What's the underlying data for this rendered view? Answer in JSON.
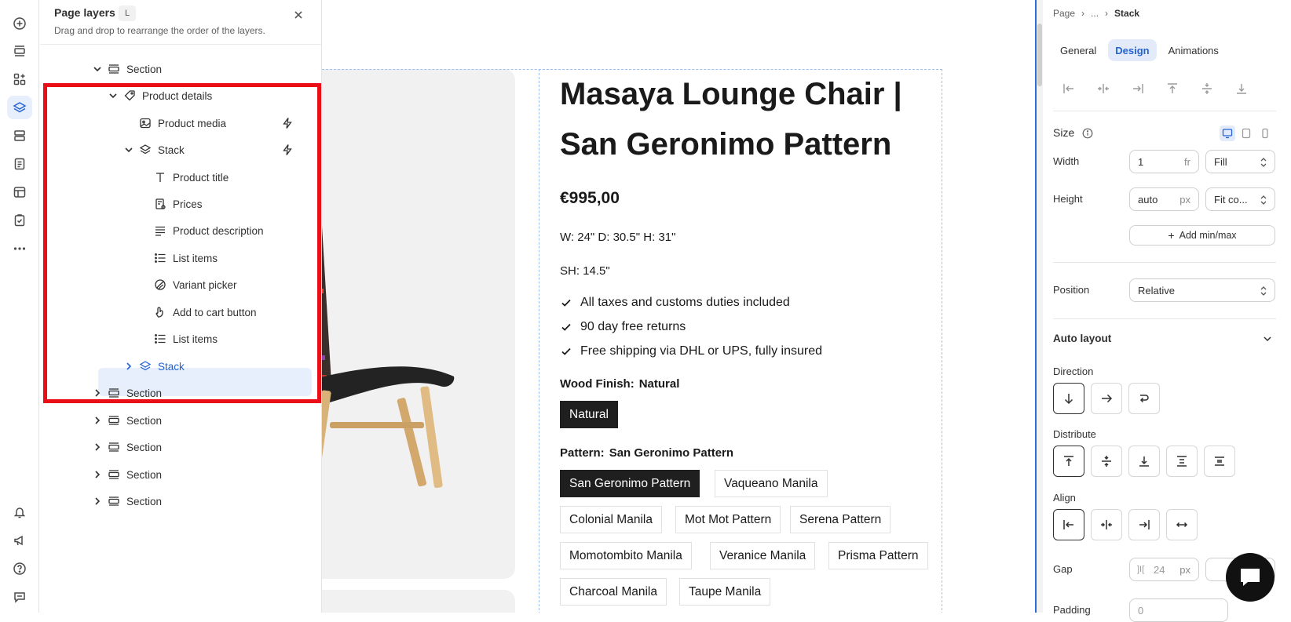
{
  "layers_panel": {
    "title": "Page layers",
    "shortcut": "L",
    "subtitle": "Drag and drop to rearrange the order of the layers.",
    "tree": [
      {
        "label": "Section",
        "icon": "section-icon",
        "expanded": true
      },
      {
        "label": "Product details",
        "icon": "tag-icon",
        "expanded": true
      },
      {
        "label": "Product media",
        "icon": "media-icon",
        "has_dynamic": true
      },
      {
        "label": "Stack",
        "icon": "stack-icon",
        "expanded": true,
        "has_dynamic": true
      },
      {
        "label": "Product title",
        "icon": "text-icon"
      },
      {
        "label": "Prices",
        "icon": "price-icon"
      },
      {
        "label": "Product description",
        "icon": "paragraph-icon"
      },
      {
        "label": "List items",
        "icon": "list-icon"
      },
      {
        "label": "Variant picker",
        "icon": "variant-icon"
      },
      {
        "label": "Add to cart button",
        "icon": "button-icon"
      },
      {
        "label": "List items",
        "icon": "list-icon"
      },
      {
        "label": "Stack",
        "icon": "stack-icon",
        "selected": true
      },
      {
        "label": "Section",
        "icon": "section-icon"
      },
      {
        "label": "Section",
        "icon": "section-icon"
      },
      {
        "label": "Section",
        "icon": "section-icon"
      },
      {
        "label": "Section",
        "icon": "section-icon"
      },
      {
        "label": "Section",
        "icon": "section-icon"
      }
    ]
  },
  "product": {
    "title_line1": "Masaya Lounge Chair |",
    "title_line2": "San Geronimo Pattern",
    "price": "€995,00",
    "dimensions": "W: 24\" D: 30.5\" H: 31\"",
    "seat_height": "SH: 14.5\"",
    "features": [
      "All taxes and customs duties included",
      "90 day free returns",
      "Free shipping via DHL or UPS, fully insured"
    ],
    "wood_finish_label": "Wood Finish:",
    "wood_finish_value": "Natural",
    "wood_finish_options": [
      "Natural"
    ],
    "pattern_label": "Pattern:",
    "pattern_value": "San Geronimo Pattern",
    "pattern_options": [
      "San Geronimo Pattern",
      "Vaqueano Manila",
      "Colonial Manila",
      "Mot Mot Pattern",
      "Serena Pattern",
      "Momotombito Manila",
      "Veranice Manila",
      "Prisma Pattern",
      "Charcoal Manila",
      "Taupe Manila"
    ]
  },
  "inspector": {
    "breadcrumb": [
      "Page",
      "...",
      "Stack"
    ],
    "tabs": [
      "General",
      "Design",
      "Animations"
    ],
    "active_tab": "Design",
    "size_label": "Size",
    "width_label": "Width",
    "width_value": "1",
    "width_unit": "fr",
    "width_mode": "Fill",
    "height_label": "Height",
    "height_value": "auto",
    "height_unit": "px",
    "height_mode": "Fit co...",
    "add_minmax": "Add min/max",
    "position_label": "Position",
    "position_value": "Relative",
    "auto_layout_label": "Auto layout",
    "direction_label": "Direction",
    "distribute_label": "Distribute",
    "align_label": "Align",
    "gap_label": "Gap",
    "gap_value": "24",
    "gap_unit": "px",
    "padding_label": "Padding",
    "padding_value": "0"
  },
  "colors": {
    "accent": "#2463d2",
    "selection_outline": "#ea0f17",
    "chip_active": "#1f1f1f"
  }
}
